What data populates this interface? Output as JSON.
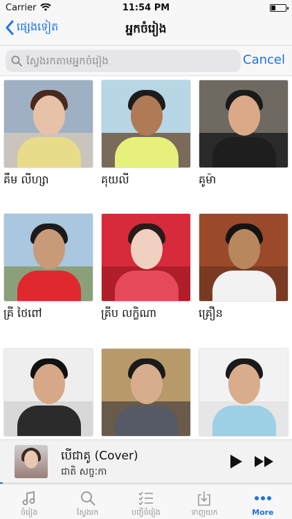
{
  "status": {
    "carrier": "Carrier",
    "time": "11:54 PM",
    "battery_level": 0.3
  },
  "nav": {
    "back_label": "ផ្សេងទៀត",
    "title": "អ្នកចំរៀង"
  },
  "search": {
    "placeholder": "ស្វែងរកតាមអ្នកចំរៀង",
    "cancel_label": "Cancel"
  },
  "artists": [
    {
      "name": "គឹម លីហ្សា",
      "colors": {
        "sky": "#9fb0c4",
        "ground": "#c9c4bd",
        "hair": "#4a2a1c",
        "face": "#e8c2a8",
        "body": "#e8dc8a"
      }
    },
    {
      "name": "គុយលី",
      "colors": {
        "sky": "#b7d6e6",
        "ground": "#7a6a5a",
        "hair": "#1c1c1c",
        "face": "#b07a55",
        "body": "#e6f07a"
      }
    },
    {
      "name": "គូម៉ា",
      "colors": {
        "sky": "#6e6a62",
        "ground": "#2a2a2a",
        "hair": "#1a1a1a",
        "face": "#d9a988",
        "body": "#1e1e1e"
      }
    },
    {
      "name": "គ្រី ថៃពៅ",
      "colors": {
        "sky": "#a9c7de",
        "ground": "#8aa07a",
        "hair": "#1b1b1b",
        "face": "#c99a78",
        "body": "#e0282f"
      }
    },
    {
      "name": "គ្រីប លក្ខិណា",
      "colors": {
        "sky": "#d72a3a",
        "ground": "#b01e2a",
        "hair": "#2a1a1a",
        "face": "#f0d0c0",
        "body": "#e64a5a"
      }
    },
    {
      "name": "គ្រឿន",
      "colors": {
        "sky": "#9a4a2a",
        "ground": "#7a3a22",
        "hair": "#141414",
        "face": "#b8875e",
        "body": "#f2f2f2"
      }
    },
    {
      "name": "",
      "colors": {
        "sky": "#eeeeee",
        "ground": "#d8d8d8",
        "hair": "#111111",
        "face": "#d6a888",
        "body": "#2b2b2b"
      }
    },
    {
      "name": "",
      "colors": {
        "sky": "#b89a6a",
        "ground": "#6a5a4a",
        "hair": "#1a1a1a",
        "face": "#d7ad8e",
        "body": "#555a66"
      }
    },
    {
      "name": "",
      "colors": {
        "sky": "#f2f2f2",
        "ground": "#e6e6e6",
        "hair": "#1a1a1a",
        "face": "#d9ad8c",
        "body": "#9ed0e6"
      }
    }
  ],
  "now_playing": {
    "title": "បើជាគូ (Cover)",
    "artist": "ជាតិ សច្ចៈកា",
    "progress": 0.01
  },
  "tabs": [
    {
      "label": "ចំរៀង",
      "icon": "music-note-icon"
    },
    {
      "label": "ស្វែងរក",
      "icon": "search-icon"
    },
    {
      "label": "បញ្ជីចំរៀង",
      "icon": "playlist-icon"
    },
    {
      "label": "ទាញយក",
      "icon": "download-icon"
    },
    {
      "label": "More",
      "icon": "more-icon"
    }
  ],
  "theme": {
    "accent": "#1a73e8"
  }
}
